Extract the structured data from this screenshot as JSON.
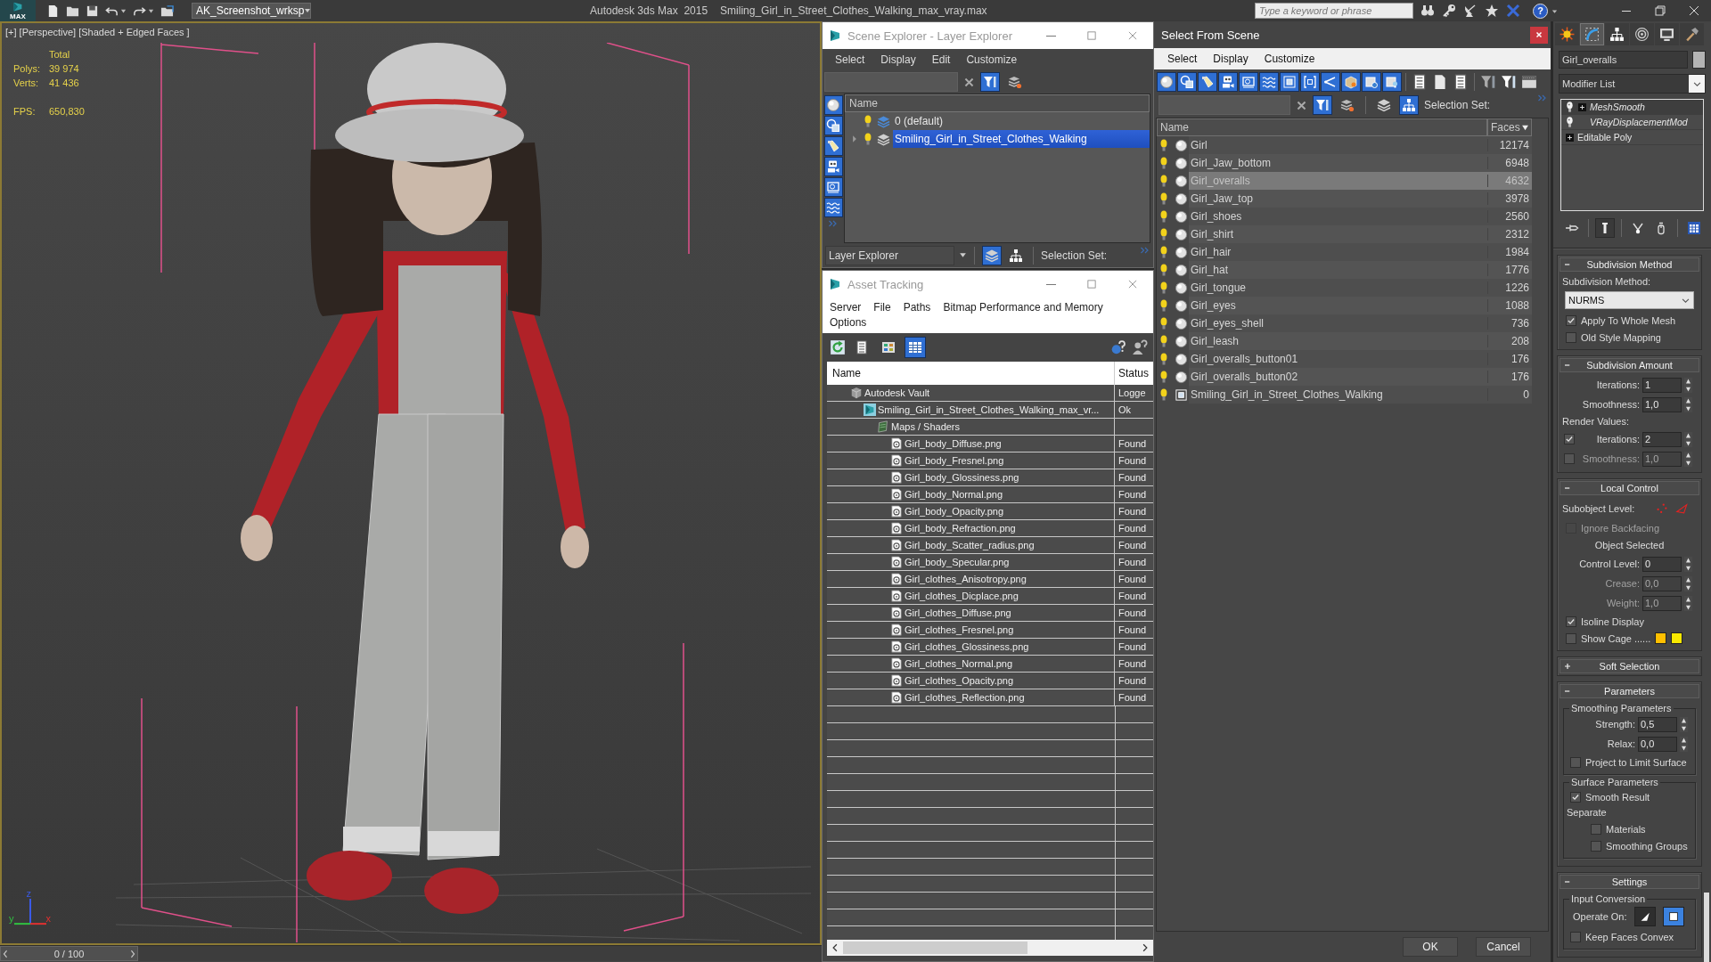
{
  "title_bar": {
    "logo_text": "MAX",
    "workspace": "AK_Screenshot_wrksp",
    "app_name": "Autodesk 3ds Max  2015",
    "file_name": "Smiling_Girl_in_Street_Clothes_Walking_max_vray.max",
    "search": {
      "placeholder": "Type a keyword or phrase"
    },
    "help": "?"
  },
  "viewport": {
    "label": "[+] [Perspective] [Shaded + Edged Faces ]",
    "stats_heading": "Total",
    "stats": [
      {
        "label": "Polys:",
        "value": "39 974"
      },
      {
        "label": "Verts:",
        "value": "41 436"
      }
    ],
    "fps": {
      "label": "FPS:",
      "value": "650,830"
    },
    "axis_labels": [
      "z",
      "y",
      "x"
    ]
  },
  "time_slider": {
    "frame": "0 / 100",
    "level": 0
  },
  "scene_explorer": {
    "title": "Scene Explorer - Layer Explorer",
    "menu": [
      "Select",
      "Display",
      "Edit",
      "Customize"
    ],
    "search_tools": [
      {
        "kind": "find_filter",
        "on": true
      },
      {
        "kind": "layer_find",
        "on": false
      }
    ],
    "filters": [
      {
        "kind": "geometry",
        "on": true
      },
      {
        "kind": "shapes",
        "on": true
      },
      {
        "kind": "lights",
        "on": true
      },
      {
        "kind": "cameras",
        "on": true
      },
      {
        "kind": "helpers",
        "on": true
      },
      {
        "kind": "space_warps",
        "on": true
      }
    ],
    "column": "Name",
    "layers": [
      {
        "name": "0 (default)",
        "expandable": false,
        "visible": true,
        "active": true,
        "selected": false
      },
      {
        "name": "Smiling_Girl_in_Street_Clothes_Walking",
        "expandable": true,
        "visible": true,
        "active": false,
        "selected": true
      }
    ],
    "mode": "Layer Explorer",
    "mode_tools": [
      {
        "kind": "layers",
        "on": true
      },
      {
        "kind": "hierarchy",
        "on": false
      }
    ],
    "selection_set_label": "Selection Set:"
  },
  "asset_tracking": {
    "title": "Asset Tracking",
    "menu": [
      "Server",
      "File",
      "Paths",
      "Bitmap Performance and Memory",
      "Options"
    ],
    "views": [
      {
        "kind": "list",
        "selected": false
      },
      {
        "kind": "thumbnails",
        "selected": false
      },
      {
        "kind": "details",
        "selected": true
      }
    ],
    "columns": [
      "Name",
      "Status"
    ],
    "tree": [
      {
        "kind": "vault",
        "name": "Autodesk Vault",
        "status": "Logge",
        "children": [
          {
            "kind": "scene_file",
            "name": "Smiling_Girl_in_Street_Clothes_Walking_max_vr...",
            "status": "Ok",
            "children": [
              {
                "kind": "maps",
                "name": "Maps / Shaders",
                "children": [
                  {
                    "kind": "bitmap",
                    "name": "Girl_body_Diffuse.png",
                    "status": "Found"
                  },
                  {
                    "kind": "bitmap",
                    "name": "Girl_body_Fresnel.png",
                    "status": "Found"
                  },
                  {
                    "kind": "bitmap",
                    "name": "Girl_body_Glossiness.png",
                    "status": "Found"
                  },
                  {
                    "kind": "bitmap",
                    "name": "Girl_body_Normal.png",
                    "status": "Found"
                  },
                  {
                    "kind": "bitmap",
                    "name": "Girl_body_Opacity.png",
                    "status": "Found"
                  },
                  {
                    "kind": "bitmap",
                    "name": "Girl_body_Refraction.png",
                    "status": "Found"
                  },
                  {
                    "kind": "bitmap",
                    "name": "Girl_body_Scatter_radius.png",
                    "status": "Found"
                  },
                  {
                    "kind": "bitmap",
                    "name": "Girl_body_Specular.png",
                    "status": "Found"
                  },
                  {
                    "kind": "bitmap",
                    "name": "Girl_clothes_Anisotropy.png",
                    "status": "Found"
                  },
                  {
                    "kind": "bitmap",
                    "name": "Girl_clothes_Dicplace.png",
                    "status": "Found"
                  },
                  {
                    "kind": "bitmap",
                    "name": "Girl_clothes_Diffuse.png",
                    "status": "Found"
                  },
                  {
                    "kind": "bitmap",
                    "name": "Girl_clothes_Fresnel.png",
                    "status": "Found"
                  },
                  {
                    "kind": "bitmap",
                    "name": "Girl_clothes_Glossiness.png",
                    "status": "Found"
                  },
                  {
                    "kind": "bitmap",
                    "name": "Girl_clothes_Normal.png",
                    "status": "Found"
                  },
                  {
                    "kind": "bitmap",
                    "name": "Girl_clothes_Opacity.png",
                    "status": "Found"
                  },
                  {
                    "kind": "bitmap",
                    "name": "Girl_clothes_Reflection.png",
                    "status": "Found"
                  }
                ]
              }
            ]
          }
        ]
      }
    ]
  },
  "select_from_scene": {
    "title": "Select From Scene",
    "menu": [
      "Select",
      "Display",
      "Customize"
    ],
    "filters": [
      {
        "kind": "geometry",
        "on": true
      },
      {
        "kind": "shapes",
        "on": true
      },
      {
        "kind": "lights",
        "on": true
      },
      {
        "kind": "cameras",
        "on": true
      },
      {
        "kind": "helpers",
        "on": true
      },
      {
        "kind": "space_warps",
        "on": true
      },
      {
        "kind": "groups",
        "on": true
      },
      {
        "kind": "xrefs",
        "on": true
      },
      {
        "kind": "bones",
        "on": true
      },
      {
        "kind": "containers",
        "on": true
      },
      {
        "kind": "frozen",
        "on": true
      },
      {
        "kind": "hidden",
        "on": true
      }
    ],
    "search_tools": [
      {
        "kind": "find_filter",
        "on": true
      },
      {
        "kind": "layer_find",
        "on": false
      },
      {
        "kind": "layers",
        "on": false
      },
      {
        "kind": "hierarchy",
        "on": true
      }
    ],
    "selection_set_label": "Selection Set:",
    "columns": [
      "Name",
      "Faces"
    ],
    "rows": [
      {
        "kind": "object",
        "name": "Girl",
        "faces": "12174",
        "visible": true,
        "selected": false
      },
      {
        "kind": "object",
        "name": "Girl_Jaw_bottom",
        "faces": "6948",
        "visible": true,
        "selected": false
      },
      {
        "kind": "object",
        "name": "Girl_overalls",
        "faces": "4632",
        "visible": true,
        "selected": true
      },
      {
        "kind": "object",
        "name": "Girl_Jaw_top",
        "faces": "3978",
        "visible": true,
        "selected": false
      },
      {
        "kind": "object",
        "name": "Girl_shoes",
        "faces": "2560",
        "visible": true,
        "selected": false
      },
      {
        "kind": "object",
        "name": "Girl_shirt",
        "faces": "2312",
        "visible": true,
        "selected": false
      },
      {
        "kind": "object",
        "name": "Girl_hair",
        "faces": "1984",
        "visible": true,
        "selected": false
      },
      {
        "kind": "object",
        "name": "Girl_hat",
        "faces": "1776",
        "visible": true,
        "selected": false
      },
      {
        "kind": "object",
        "name": "Girl_tongue",
        "faces": "1226",
        "visible": true,
        "selected": false
      },
      {
        "kind": "object",
        "name": "Girl_eyes",
        "faces": "1088",
        "visible": true,
        "selected": false
      },
      {
        "kind": "object",
        "name": "Girl_eyes_shell",
        "faces": "736",
        "visible": true,
        "selected": false
      },
      {
        "kind": "object",
        "name": "Girl_leash",
        "faces": "208",
        "visible": true,
        "selected": false
      },
      {
        "kind": "object",
        "name": "Girl_overalls_button01",
        "faces": "176",
        "visible": true,
        "selected": false
      },
      {
        "kind": "object",
        "name": "Girl_overalls_button02",
        "faces": "176",
        "visible": true,
        "selected": false
      },
      {
        "kind": "group",
        "name": "Smiling_Girl_in_Street_Clothes_Walking",
        "faces": "0",
        "visible": true,
        "selected": false
      }
    ],
    "buttons": [
      "OK",
      "Cancel"
    ]
  },
  "command_panel": {
    "tabs": [
      {
        "kind": "create",
        "selected": false
      },
      {
        "kind": "modify",
        "selected": true
      },
      {
        "kind": "hierarchy",
        "selected": false
      },
      {
        "kind": "motion",
        "selected": false
      },
      {
        "kind": "display",
        "selected": false
      },
      {
        "kind": "utilities",
        "selected": false
      }
    ],
    "object_name": "Girl_overalls",
    "modifier_list": "Modifier List",
    "stack": [
      {
        "kind": "modifier",
        "name": "MeshSmooth",
        "enabled": true,
        "expandable": true,
        "selected": true
      },
      {
        "kind": "modifier",
        "name": "VRayDisplacementMod",
        "enabled": true,
        "expandable": false,
        "selected": false
      },
      {
        "kind": "base",
        "name": "Editable Poly",
        "expandable": true,
        "selected": false
      }
    ],
    "stack_tools": [
      {
        "kind": "pin",
        "on": false
      },
      {
        "kind": "end_result",
        "on": true
      },
      {
        "kind": "make_unique",
        "on": false
      },
      {
        "kind": "remove",
        "on": false
      },
      {
        "kind": "configure",
        "on": false
      }
    ],
    "rollouts": [
      {
        "title": "Subdivision Method",
        "expanded": true,
        "controls": [
          {
            "kind": "caption",
            "text": "Subdivision Method:"
          },
          {
            "kind": "dropdown",
            "value": "NURMS"
          },
          {
            "kind": "checkbox",
            "label": "Apply To Whole Mesh",
            "checked": true,
            "disabled": false
          },
          {
            "kind": "checkbox",
            "label": "Old Style Mapping",
            "checked": false,
            "disabled": false
          }
        ]
      },
      {
        "title": "Subdivision Amount",
        "expanded": true,
        "controls": [
          {
            "kind": "spinner",
            "label": "Iterations:",
            "value": "1",
            "disabled": false
          },
          {
            "kind": "spinner",
            "label": "Smoothness:",
            "value": "1,0",
            "disabled": false
          },
          {
            "kind": "caption",
            "text": "Render Values:"
          },
          {
            "kind": "check_spinner",
            "label": "Iterations:",
            "value": "2",
            "checked": true
          },
          {
            "kind": "check_spinner",
            "label": "Smoothness:",
            "value": "1,0",
            "checked": false
          }
        ]
      },
      {
        "title": "Local Control",
        "expanded": true,
        "controls": [
          {
            "kind": "subobject",
            "label": "Subobject Level:"
          },
          {
            "kind": "checkbox",
            "label": "Ignore Backfacing",
            "checked": false,
            "disabled": true
          },
          {
            "kind": "note",
            "text": "Object Selected"
          },
          {
            "kind": "spinner",
            "label": "Control Level:",
            "value": "0",
            "disabled": false
          },
          {
            "kind": "spinner",
            "label": "Crease:",
            "value": "0,0",
            "disabled": true
          },
          {
            "kind": "spinner",
            "label": "Weight:",
            "value": "1,0",
            "disabled": true
          },
          {
            "kind": "checkbox",
            "label": "Isoline Display",
            "checked": true,
            "disabled": false
          },
          {
            "kind": "cage",
            "label": "Show Cage ......",
            "checked": false,
            "swatches": [
              {
                "color": "#ffbf00"
              },
              {
                "color": "#f8e800"
              }
            ]
          }
        ]
      },
      {
        "title": "Soft Selection",
        "expanded": false
      },
      {
        "title": "Parameters",
        "expanded": true,
        "controls": [
          {
            "kind": "group",
            "title": "Smoothing Parameters",
            "controls": [
              {
                "kind": "spinner",
                "label": "Strength:",
                "value": "0,5",
                "disabled": false
              },
              {
                "kind": "spinner",
                "label": "Relax:",
                "value": "0,0",
                "disabled": false
              },
              {
                "kind": "checkbox",
                "label": "Project to Limit Surface",
                "checked": false,
                "disabled": false
              }
            ]
          },
          {
            "kind": "group",
            "title": "Surface Parameters",
            "controls": [
              {
                "kind": "checkbox",
                "label": "Smooth Result",
                "checked": true,
                "disabled": false
              },
              {
                "kind": "caption",
                "text": "Separate"
              },
              {
                "kind": "sub_checkbox",
                "label": "Materials",
                "checked": false,
                "disabled": false
              },
              {
                "kind": "sub_checkbox",
                "label": "Smoothing Groups",
                "checked": false,
                "disabled": false
              }
            ]
          }
        ]
      },
      {
        "title": "Settings",
        "expanded": true,
        "controls": [
          {
            "kind": "group",
            "title": "Input Conversion",
            "controls": [
              {
                "kind": "operate_on",
                "label": "Operate On:",
                "options": [
                  {
                    "kind": "triangles",
                    "selected": false
                  },
                  {
                    "kind": "polygons",
                    "selected": true
                  }
                ]
              },
              {
                "kind": "checkbox",
                "label": "Keep Faces Convex",
                "checked": false,
                "disabled": false
              }
            ]
          }
        ]
      }
    ]
  }
}
